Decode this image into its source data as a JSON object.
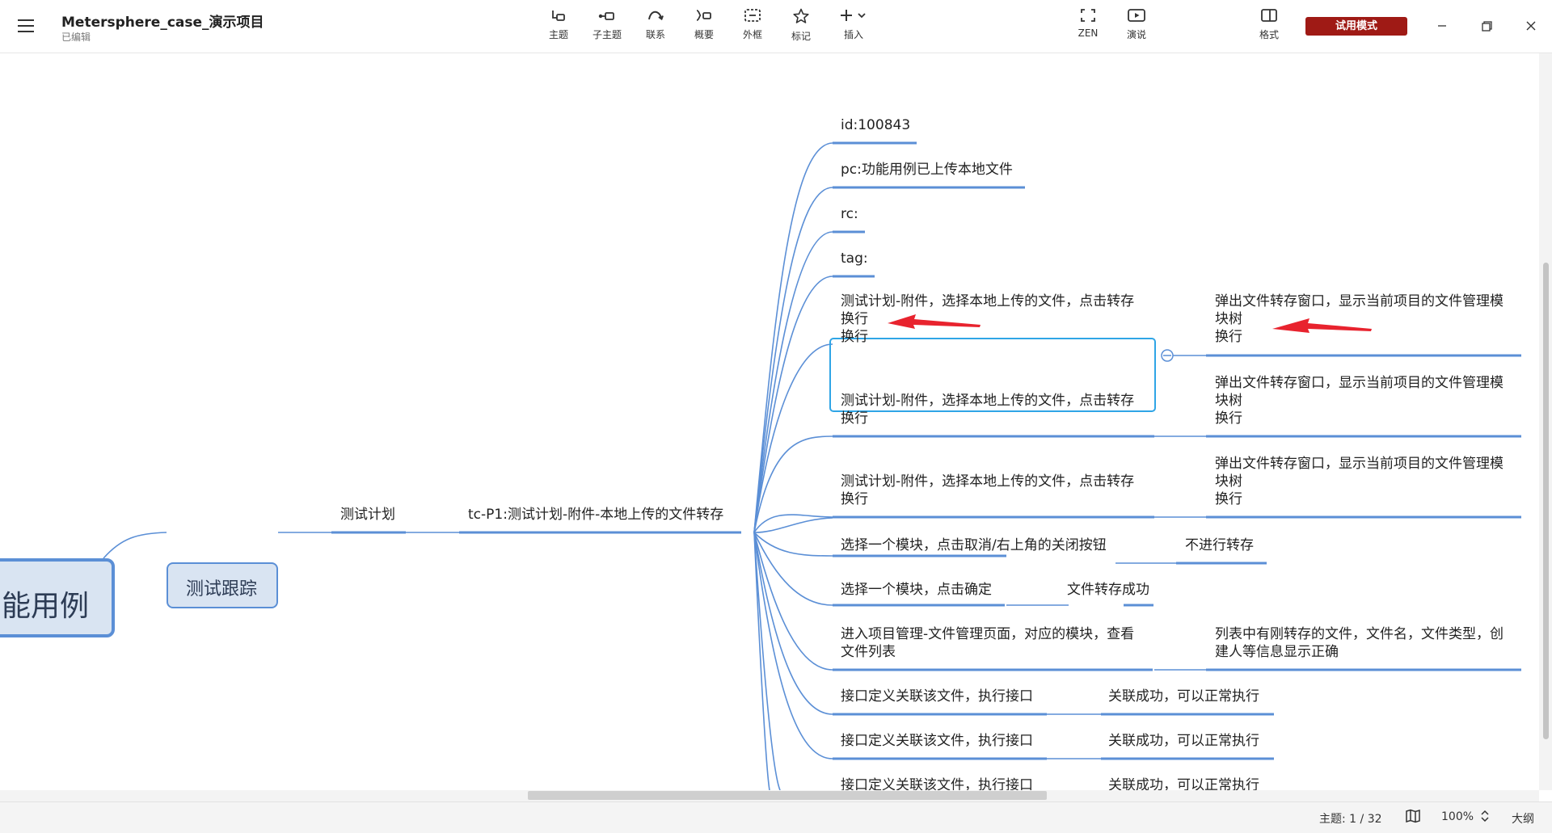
{
  "app": {
    "title": "Metersphere_case_演示项目",
    "status": "已编辑"
  },
  "toolbar": {
    "items": [
      {
        "label": "主题",
        "icon": "topic-icon"
      },
      {
        "label": "子主题",
        "icon": "subtopic-icon"
      },
      {
        "label": "联系",
        "icon": "relationship-icon"
      },
      {
        "label": "概要",
        "icon": "summary-icon"
      },
      {
        "label": "外框",
        "icon": "boundary-icon"
      },
      {
        "label": "标记",
        "icon": "star-icon"
      },
      {
        "label": "插入",
        "icon": "plus-icon"
      },
      {
        "label": "ZEN",
        "icon": "fullscreen-icon"
      },
      {
        "label": "演说",
        "icon": "play-icon"
      },
      {
        "label": "格式",
        "icon": "panel-icon"
      }
    ],
    "trial_label": "试用模式"
  },
  "colors": {
    "accent": "#5b8fd6",
    "selection": "#2fa5e6",
    "trial": "#9f1a15",
    "arrow": "#e8232e"
  },
  "mindmap": {
    "root": "能用例",
    "main": "测试跟踪",
    "level2": "测试计划",
    "level3": "tc-P1:测试计划-附件-本地上传的文件转存",
    "branches": [
      {
        "text": "id:100843"
      },
      {
        "text": "pc:功能用例已上传本地文件"
      },
      {
        "text": "rc:"
      },
      {
        "text": "tag:"
      },
      {
        "text": "测试计划-附件，选择本地上传的文件，点击转存\n换行\n换行",
        "result": "弹出文件转存窗口，显示当前项目的文件管理模\n块树\n换行",
        "selected": true
      },
      {
        "text": "测试计划-附件，选择本地上传的文件，点击转存\n换行",
        "result": "弹出文件转存窗口，显示当前项目的文件管理模\n块树\n换行"
      },
      {
        "text": "测试计划-附件，选择本地上传的文件，点击转存\n换行",
        "result": "弹出文件转存窗口，显示当前项目的文件管理模\n块树\n换行"
      },
      {
        "text": "选择一个模块，点击取消/右上角的关闭按钮",
        "result": "不进行转存"
      },
      {
        "text": "选择一个模块，点击确定",
        "result": "文件转存成功"
      },
      {
        "text": "进入项目管理-文件管理页面，对应的模块，查看\n文件列表",
        "result": "列表中有刚转存的文件，文件名，文件类型，创\n建人等信息显示正确"
      },
      {
        "text": "接口定义关联该文件，执行接口",
        "result": "关联成功，可以正常执行"
      },
      {
        "text": "接口定义关联该文件，执行接口",
        "result": "关联成功，可以正常执行"
      },
      {
        "text": "接口定义关联该文件，执行接口",
        "result": "关联成功，可以正常执行"
      }
    ]
  },
  "statusbar": {
    "topic_count": "主题: 1 / 32",
    "zoom": "100%",
    "outline": "大纲"
  }
}
